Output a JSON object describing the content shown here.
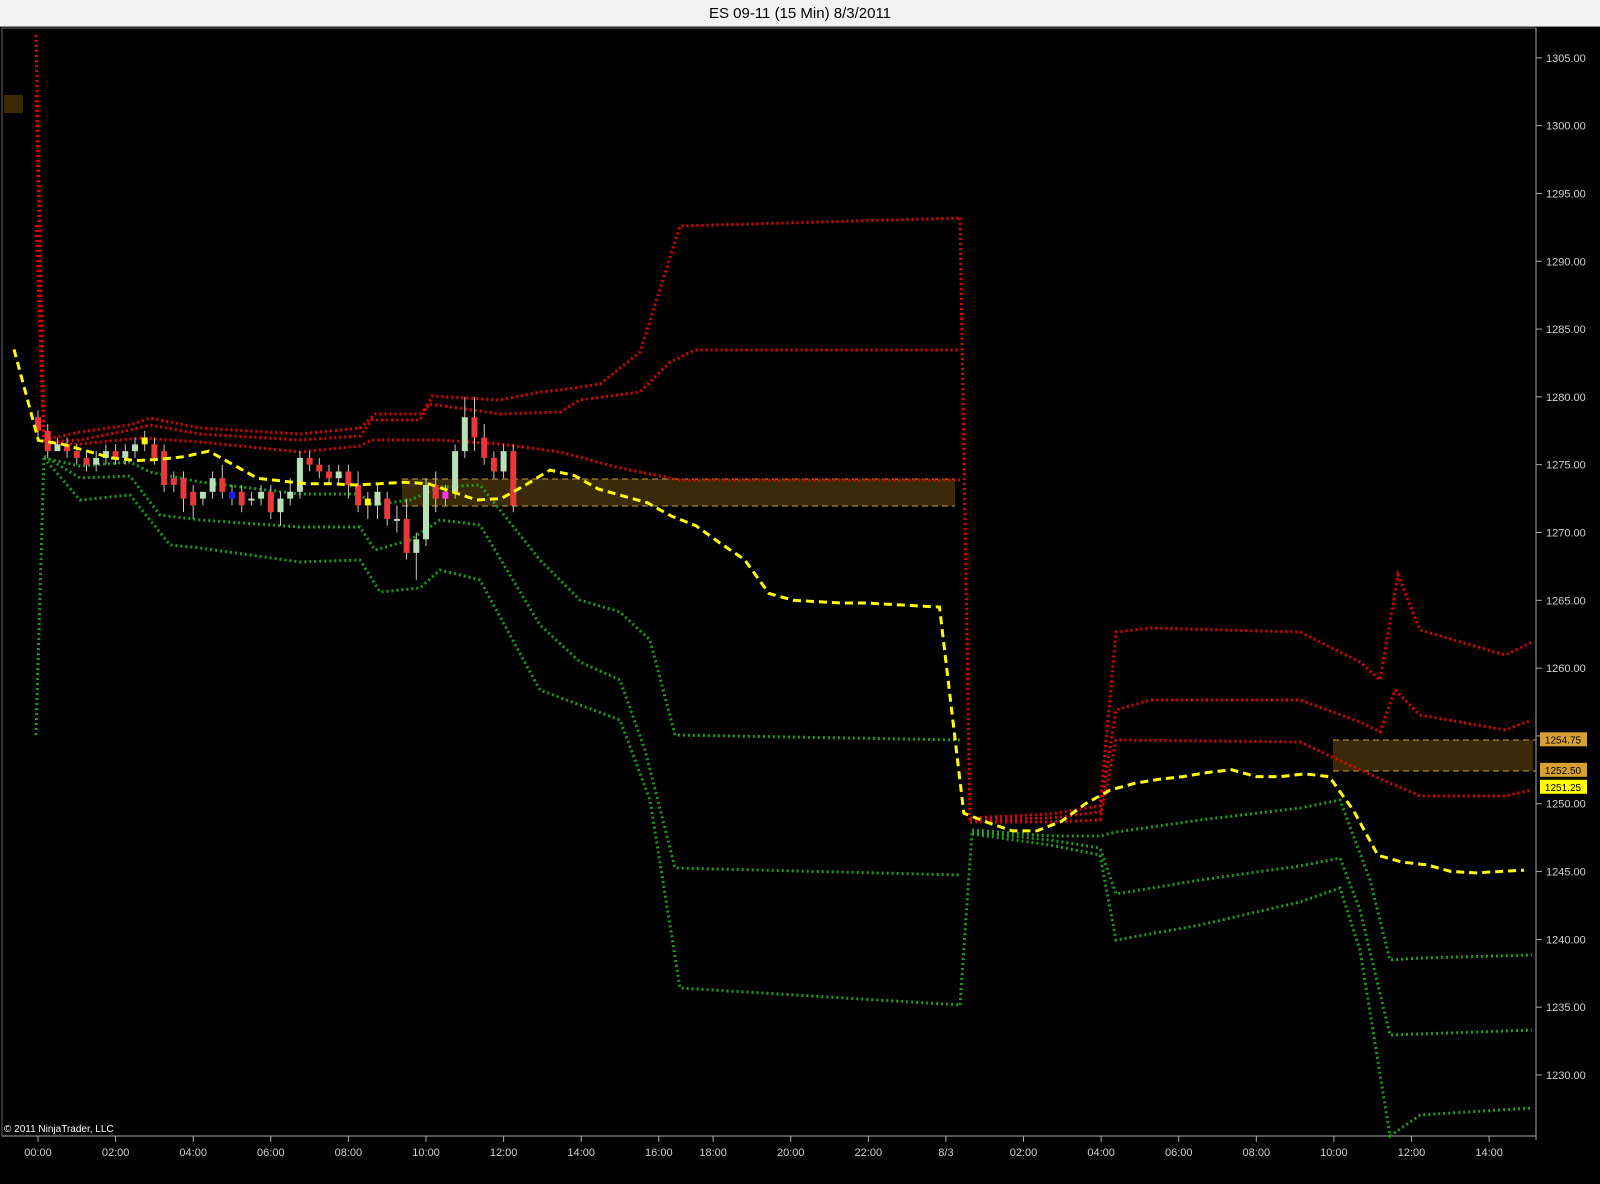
{
  "window": {
    "title": "ES 09-11 (15 Min)  8/3/2011"
  },
  "copyright": "© 2011 NinjaTrader, LLC",
  "colors": {
    "background": "#000000",
    "up_candle": "#b8e0b8",
    "down_candle": "#e8383a",
    "yellow_candle": "#ffff00",
    "blue_candle": "#1a1aff",
    "magenta_candle": "#ff33ff",
    "vwap": "#ffff00",
    "upper_band": "#e00000",
    "lower_band": "#1f9a1f",
    "zone_fill": "#3a2a08",
    "zone_edge": "#c8a040"
  },
  "chart_data": {
    "type": "candlestick",
    "title": "ES 09-11 (15 Min)  8/3/2011",
    "ylim": [
      1225.5,
      1307.2
    ],
    "y_ticks": [
      "1305.00",
      "1300.00",
      "1295.00",
      "1290.00",
      "1285.00",
      "1280.00",
      "1275.00",
      "1270.00",
      "1265.00",
      "1260.00",
      "1255.00",
      "1250.00",
      "1245.00",
      "1240.00",
      "1235.00",
      "1230.00"
    ],
    "x_ticks": [
      {
        "label": "00:00",
        "bar": 0
      },
      {
        "label": "02:00",
        "bar": 8
      },
      {
        "label": "04:00",
        "bar": 16
      },
      {
        "label": "06:00",
        "bar": 24
      },
      {
        "label": "08:00",
        "bar": 32
      },
      {
        "label": "10:00",
        "bar": 40
      },
      {
        "label": "12:00",
        "bar": 48
      },
      {
        "label": "14:00",
        "bar": 56
      },
      {
        "label": "16:00",
        "bar": 64
      },
      {
        "label": "18:00",
        "bar": 69.6
      },
      {
        "label": "20:00",
        "bar": 77.6
      },
      {
        "label": "22:00",
        "bar": 85.6
      },
      {
        "label": "8/3",
        "bar": 93.6
      },
      {
        "label": "02:00",
        "bar": 101.6
      },
      {
        "label": "04:00",
        "bar": 109.6
      },
      {
        "label": "06:00",
        "bar": 117.6
      },
      {
        "label": "08:00",
        "bar": 125.6
      },
      {
        "label": "10:00",
        "bar": 133.6
      },
      {
        "label": "12:00",
        "bar": 141.6
      },
      {
        "label": "14:00",
        "bar": 149.6
      }
    ],
    "bar_spacing_px": 9.7,
    "price_labels": [
      {
        "text": "1254.75",
        "value": 1254.75,
        "color": "#d8a030"
      },
      {
        "text": "1252.50",
        "value": 1252.5,
        "color": "#d8a030"
      },
      {
        "text": "1251.25",
        "value": 1251.25,
        "color": "#ffff00"
      }
    ],
    "candles": [
      {
        "o": 1278.5,
        "h": 1279.0,
        "l": 1277.0,
        "c": 1277.5
      },
      {
        "o": 1277.5,
        "h": 1278.0,
        "l": 1275.5,
        "c": 1276.0
      },
      {
        "o": 1276.0,
        "h": 1277.0,
        "l": 1276.0,
        "c": 1276.5
      },
      {
        "o": 1276.5,
        "h": 1277.0,
        "l": 1275.5,
        "c": 1276.0
      },
      {
        "o": 1276.0,
        "h": 1276.5,
        "l": 1275.0,
        "c": 1275.5
      },
      {
        "o": 1275.5,
        "h": 1276.0,
        "l": 1274.5,
        "c": 1275.0
      },
      {
        "o": 1275.0,
        "h": 1276.0,
        "l": 1274.5,
        "c": 1275.5
      },
      {
        "o": 1275.5,
        "h": 1276.5,
        "l": 1275.0,
        "c": 1276.0
      },
      {
        "o": 1276.0,
        "h": 1276.5,
        "l": 1275.0,
        "c": 1275.5
      },
      {
        "o": 1275.5,
        "h": 1276.5,
        "l": 1275.0,
        "c": 1276.0
      },
      {
        "o": 1276.0,
        "h": 1277.0,
        "l": 1275.5,
        "c": 1276.5
      },
      {
        "o": 1276.5,
        "h": 1277.5,
        "l": 1276.0,
        "c": 1277.0
      },
      {
        "o": 1276.5,
        "h": 1277.0,
        "l": 1275.0,
        "c": 1275.5
      },
      {
        "o": 1276.0,
        "h": 1276.5,
        "l": 1273.0,
        "c": 1273.5
      },
      {
        "o": 1274.0,
        "h": 1274.5,
        "l": 1273.0,
        "c": 1273.5
      },
      {
        "o": 1274.0,
        "h": 1274.5,
        "l": 1271.5,
        "c": 1272.5
      },
      {
        "o": 1273.0,
        "h": 1273.5,
        "l": 1271.0,
        "c": 1272.0
      },
      {
        "o": 1272.5,
        "h": 1273.0,
        "l": 1272.0,
        "c": 1273.0
      },
      {
        "o": 1273.0,
        "h": 1274.5,
        "l": 1272.5,
        "c": 1274.0
      },
      {
        "o": 1274.0,
        "h": 1275.0,
        "l": 1272.5,
        "c": 1273.0
      },
      {
        "o": 1273.0,
        "h": 1273.5,
        "l": 1272.0,
        "c": 1272.5
      },
      {
        "o": 1273.0,
        "h": 1273.5,
        "l": 1271.5,
        "c": 1272.0
      },
      {
        "o": 1272.5,
        "h": 1273.0,
        "l": 1272.0,
        "c": 1272.5
      },
      {
        "o": 1272.5,
        "h": 1273.5,
        "l": 1272.0,
        "c": 1273.0
      },
      {
        "o": 1273.0,
        "h": 1273.5,
        "l": 1271.0,
        "c": 1271.5
      },
      {
        "o": 1271.5,
        "h": 1273.0,
        "l": 1270.5,
        "c": 1272.5
      },
      {
        "o": 1272.5,
        "h": 1274.0,
        "l": 1272.0,
        "c": 1273.0
      },
      {
        "o": 1273.0,
        "h": 1276.0,
        "l": 1272.5,
        "c": 1275.5
      },
      {
        "o": 1275.5,
        "h": 1276.0,
        "l": 1274.5,
        "c": 1275.0
      },
      {
        "o": 1275.0,
        "h": 1275.5,
        "l": 1274.0,
        "c": 1274.5
      },
      {
        "o": 1274.5,
        "h": 1275.0,
        "l": 1273.5,
        "c": 1274.0
      },
      {
        "o": 1274.0,
        "h": 1275.0,
        "l": 1273.5,
        "c": 1274.5
      },
      {
        "o": 1274.5,
        "h": 1275.0,
        "l": 1272.5,
        "c": 1273.5
      },
      {
        "o": 1273.5,
        "h": 1274.5,
        "l": 1271.5,
        "c": 1272.0
      },
      {
        "o": 1272.5,
        "h": 1273.0,
        "l": 1271.0,
        "c": 1272.0
      },
      {
        "o": 1272.0,
        "h": 1273.5,
        "l": 1271.0,
        "c": 1273.0
      },
      {
        "o": 1272.5,
        "h": 1273.0,
        "l": 1270.5,
        "c": 1271.0
      },
      {
        "o": 1271.0,
        "h": 1272.0,
        "l": 1270.0,
        "c": 1271.0
      },
      {
        "o": 1271.0,
        "h": 1272.5,
        "l": 1268.0,
        "c": 1268.5
      },
      {
        "o": 1268.5,
        "h": 1270.0,
        "l": 1266.5,
        "c": 1269.5
      },
      {
        "o": 1269.5,
        "h": 1274.0,
        "l": 1269.0,
        "c": 1273.5
      },
      {
        "o": 1273.5,
        "h": 1274.5,
        "l": 1271.5,
        "c": 1272.5
      },
      {
        "o": 1272.5,
        "h": 1273.5,
        "l": 1272.0,
        "c": 1273.0
      },
      {
        "o": 1273.0,
        "h": 1276.5,
        "l": 1272.5,
        "c": 1276.0
      },
      {
        "o": 1276.0,
        "h": 1280.0,
        "l": 1275.5,
        "c": 1278.5
      },
      {
        "o": 1278.5,
        "h": 1280.0,
        "l": 1276.0,
        "c": 1277.0
      },
      {
        "o": 1277.0,
        "h": 1278.0,
        "l": 1275.0,
        "c": 1275.5
      },
      {
        "o": 1275.5,
        "h": 1276.0,
        "l": 1274.0,
        "c": 1274.5
      },
      {
        "o": 1274.5,
        "h": 1276.5,
        "l": 1274.0,
        "c": 1276.0
      },
      {
        "o": 1276.0,
        "h": 1276.5,
        "l": 1271.5,
        "c": 1272.0
      }
    ],
    "series": [
      {
        "name": "VWAP",
        "values": [
          1283.5,
          1276.8,
          1276.5,
          1276.0,
          1275.5,
          1275.3,
          1275.4,
          1275.6,
          1276.0,
          1275.0,
          1274.0,
          1273.8,
          1273.6,
          1273.6,
          1273.5,
          1273.6,
          1273.7,
          1273.6,
          1273.0,
          1272.4,
          1272.5,
          1273.5,
          1274.6,
          1274.2,
          1273.2,
          1272.7,
          1272.2,
          1271.2,
          1270.5,
          1269.2,
          1268.0,
          1265.5,
          1265.0,
          1264.9,
          1264.8,
          1264.8,
          1264.7,
          1264.6,
          1264.5,
          1249.3,
          1248.6,
          1248.0,
          1248.0,
          1248.7,
          1250.0,
          1251.0,
          1251.5,
          1251.8,
          1252.0,
          1252.3,
          1252.5,
          1252.0,
          1252.0,
          1252.2,
          1252.0,
          1249.5,
          1246.2,
          1245.7,
          1245.5,
          1245.0,
          1244.9,
          1245.0,
          1245.1
        ]
      }
    ]
  }
}
